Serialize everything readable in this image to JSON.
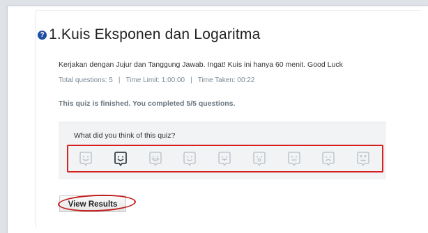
{
  "quiz": {
    "title": "1.Kuis Eksponen dan Logaritma",
    "description": "Kerjakan dengan Jujur dan Tanggung Jawab. Ingat! Kuis ini hanya 60 menit. Good Luck",
    "total_questions": "Total questions: 5",
    "time_limit": "Time Limit: 1:00:00",
    "time_taken": "Time Taken: 00:22",
    "separator": "|",
    "status": "This quiz is finished. You completed 5/5 questions."
  },
  "feedback": {
    "prompt": "What did you think of this quiz?",
    "faces": [
      "happy",
      "smile",
      "grin",
      "wink",
      "tongue",
      "surprised",
      "neutral",
      "sad",
      "angry"
    ],
    "selected_index": 1
  },
  "actions": {
    "view_results_label": "View Results"
  },
  "colors": {
    "highlight_red": "#d62020",
    "question_icon_blue": "#1d4ea0",
    "face_default": "#b8bec6",
    "face_selected": "#3a3f46"
  },
  "icons": {
    "title_icon": "question-icon"
  }
}
